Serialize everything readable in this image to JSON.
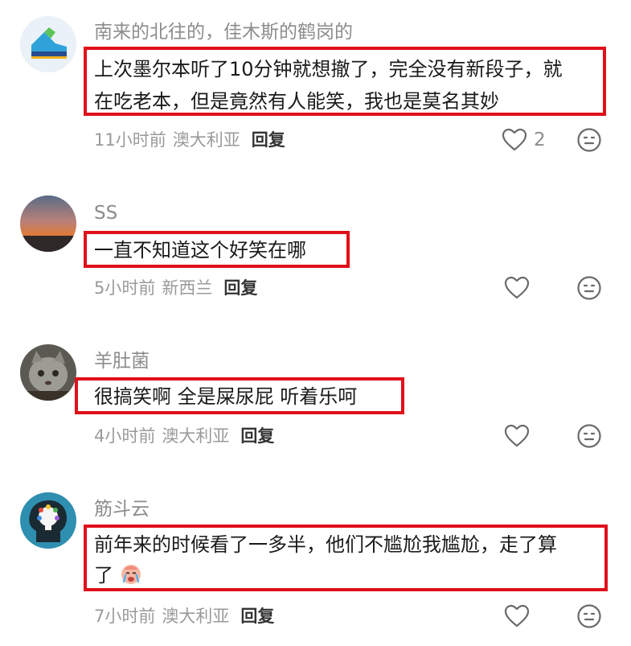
{
  "comments": [
    {
      "username": "南来的北往的，佳木斯的鹤岗的",
      "text_lines": [
        "上次墨尔本听了10分钟就想撤了，完全没有新段子，就",
        "在吃老本，但是竟然有人能笑，我也是莫名其妙"
      ],
      "time": "11小时前",
      "location": "澳大利亚",
      "reply_label": "回复",
      "likes": "2",
      "avatar_icon": "shoe-icon"
    },
    {
      "username": "SS",
      "text_lines": [
        "一直不知道这个好笑在哪"
      ],
      "time": "5小时前",
      "location": "新西兰",
      "reply_label": "回复",
      "likes": "",
      "avatar_icon": "sunset-photo"
    },
    {
      "username": "羊肚菌",
      "text_lines": [
        "很搞笑啊 全是屎尿屁 听着乐呵"
      ],
      "time": "4小时前",
      "location": "澳大利亚",
      "reply_label": "回复",
      "likes": "",
      "avatar_icon": "cat-photo"
    },
    {
      "username": "筋斗云",
      "text_lines": [
        "前年来的时候看了一多半，他们不尴尬我尴尬，走了算",
        "了"
      ],
      "time": "7小时前",
      "location": "澳大利亚",
      "reply_label": "回复",
      "likes": "",
      "avatar_icon": "head-lightbulb-icon",
      "trailing_emoji": "crying-emoji"
    }
  ],
  "colors": {
    "highlight_box": "#e0101a",
    "meta_text": "#9a9a9a",
    "username": "#8c8c8c"
  }
}
